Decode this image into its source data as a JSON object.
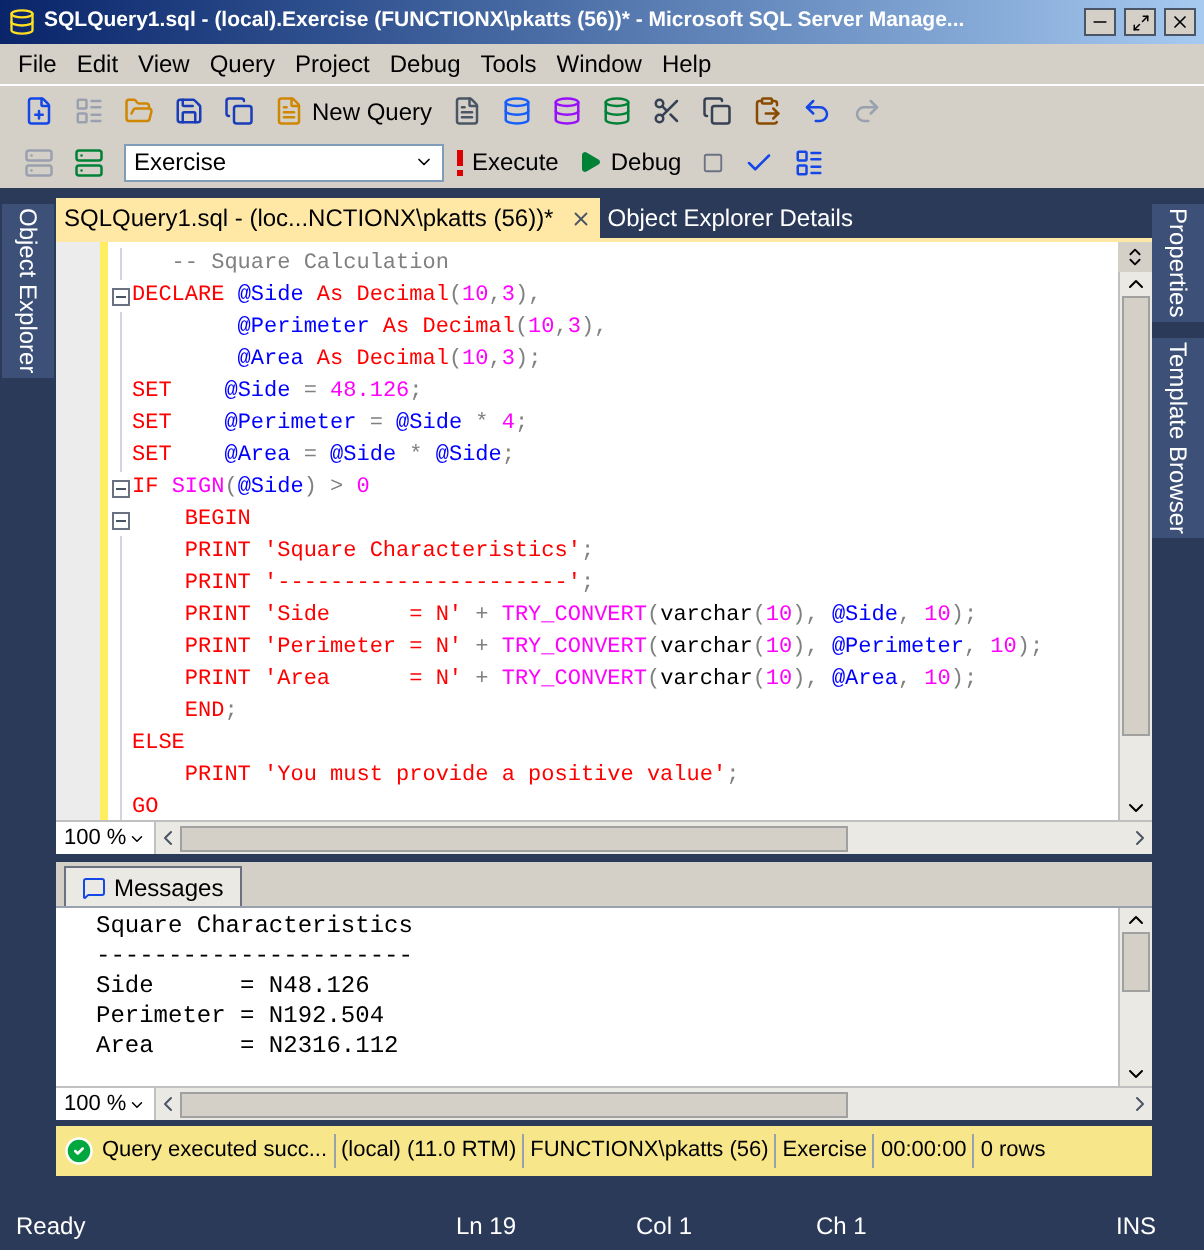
{
  "window": {
    "title": "SQLQuery1.sql - (local).Exercise (FUNCTIONX\\pkatts (56))* - Microsoft SQL Server Manage..."
  },
  "menu": [
    "File",
    "Edit",
    "View",
    "Query",
    "Project",
    "Debug",
    "Tools",
    "Window",
    "Help"
  ],
  "toolbar": {
    "new_query": "New Query",
    "database": "Exercise",
    "execute": "Execute",
    "debug": "Debug"
  },
  "side_left": [
    "Object Explorer"
  ],
  "side_right": [
    "Properties",
    "Template Browser"
  ],
  "tabs": [
    {
      "label": "SQLQuery1.sql - (loc...NCTIONX\\pkatts (56))*",
      "selected": true
    },
    {
      "label": "Object Explorer Details",
      "selected": false
    }
  ],
  "editor": {
    "lines": [
      {
        "fold": false,
        "tokens": [
          {
            "kind": "comment",
            "text": "   -- Square Calculation"
          }
        ]
      },
      {
        "fold": true,
        "tokens": [
          {
            "kind": "kw",
            "text": "DECLARE "
          },
          {
            "kind": "var",
            "text": "@Side "
          },
          {
            "kind": "kw",
            "text": "As Decimal"
          },
          {
            "kind": "op",
            "text": "("
          },
          {
            "kind": "num",
            "text": "10"
          },
          {
            "kind": "op",
            "text": ","
          },
          {
            "kind": "num",
            "text": "3"
          },
          {
            "kind": "op",
            "text": "),"
          }
        ]
      },
      {
        "fold": false,
        "tokens": [
          {
            "kind": "var",
            "text": "        @Perimeter "
          },
          {
            "kind": "kw",
            "text": "As Decimal"
          },
          {
            "kind": "op",
            "text": "("
          },
          {
            "kind": "num",
            "text": "10"
          },
          {
            "kind": "op",
            "text": ","
          },
          {
            "kind": "num",
            "text": "3"
          },
          {
            "kind": "op",
            "text": "),"
          }
        ]
      },
      {
        "fold": false,
        "tokens": [
          {
            "kind": "var",
            "text": "        @Area "
          },
          {
            "kind": "kw",
            "text": "As Decimal"
          },
          {
            "kind": "op",
            "text": "("
          },
          {
            "kind": "num",
            "text": "10"
          },
          {
            "kind": "op",
            "text": ","
          },
          {
            "kind": "num",
            "text": "3"
          },
          {
            "kind": "op",
            "text": ");"
          }
        ]
      },
      {
        "fold": false,
        "tokens": [
          {
            "kind": "kw",
            "text": "SET    "
          },
          {
            "kind": "var",
            "text": "@Side"
          },
          {
            "kind": "op",
            "text": " = "
          },
          {
            "kind": "num",
            "text": "48.126"
          },
          {
            "kind": "op",
            "text": ";"
          }
        ]
      },
      {
        "fold": false,
        "tokens": [
          {
            "kind": "kw",
            "text": "SET    "
          },
          {
            "kind": "var",
            "text": "@Perimeter"
          },
          {
            "kind": "op",
            "text": " = "
          },
          {
            "kind": "var",
            "text": "@Side"
          },
          {
            "kind": "op",
            "text": " * "
          },
          {
            "kind": "num",
            "text": "4"
          },
          {
            "kind": "op",
            "text": ";"
          }
        ]
      },
      {
        "fold": false,
        "tokens": [
          {
            "kind": "kw",
            "text": "SET    "
          },
          {
            "kind": "var",
            "text": "@Area"
          },
          {
            "kind": "op",
            "text": " = "
          },
          {
            "kind": "var",
            "text": "@Side"
          },
          {
            "kind": "op",
            "text": " * "
          },
          {
            "kind": "var",
            "text": "@Side"
          },
          {
            "kind": "op",
            "text": ";"
          }
        ]
      },
      {
        "fold": true,
        "tokens": [
          {
            "kind": "kw",
            "text": "IF "
          },
          {
            "kind": "fn",
            "text": "SIGN"
          },
          {
            "kind": "op",
            "text": "("
          },
          {
            "kind": "var",
            "text": "@Side"
          },
          {
            "kind": "op",
            "text": ") > "
          },
          {
            "kind": "num",
            "text": "0"
          }
        ]
      },
      {
        "fold": true,
        "tokens": [
          {
            "kind": "kw",
            "text": "    BEGIN"
          }
        ]
      },
      {
        "fold": false,
        "tokens": [
          {
            "kind": "kw",
            "text": "    PRINT "
          },
          {
            "kind": "str",
            "text": "'Square Characteristics'"
          },
          {
            "kind": "op",
            "text": ";"
          }
        ]
      },
      {
        "fold": false,
        "tokens": [
          {
            "kind": "kw",
            "text": "    PRINT "
          },
          {
            "kind": "str",
            "text": "'----------------------'"
          },
          {
            "kind": "op",
            "text": ";"
          }
        ]
      },
      {
        "fold": false,
        "tokens": [
          {
            "kind": "kw",
            "text": "    PRINT "
          },
          {
            "kind": "str",
            "text": "'Side      = N'"
          },
          {
            "kind": "op",
            "text": " + "
          },
          {
            "kind": "fn",
            "text": "TRY_CONVERT"
          },
          {
            "kind": "op",
            "text": "("
          },
          {
            "kind": "plain",
            "text": "varchar"
          },
          {
            "kind": "op",
            "text": "("
          },
          {
            "kind": "num",
            "text": "10"
          },
          {
            "kind": "op",
            "text": "), "
          },
          {
            "kind": "var",
            "text": "@Side"
          },
          {
            "kind": "op",
            "text": ", "
          },
          {
            "kind": "num",
            "text": "10"
          },
          {
            "kind": "op",
            "text": ");"
          }
        ]
      },
      {
        "fold": false,
        "tokens": [
          {
            "kind": "kw",
            "text": "    PRINT "
          },
          {
            "kind": "str",
            "text": "'Perimeter = N'"
          },
          {
            "kind": "op",
            "text": " + "
          },
          {
            "kind": "fn",
            "text": "TRY_CONVERT"
          },
          {
            "kind": "op",
            "text": "("
          },
          {
            "kind": "plain",
            "text": "varchar"
          },
          {
            "kind": "op",
            "text": "("
          },
          {
            "kind": "num",
            "text": "10"
          },
          {
            "kind": "op",
            "text": "), "
          },
          {
            "kind": "var",
            "text": "@Perimeter"
          },
          {
            "kind": "op",
            "text": ", "
          },
          {
            "kind": "num",
            "text": "10"
          },
          {
            "kind": "op",
            "text": ");"
          }
        ]
      },
      {
        "fold": false,
        "tokens": [
          {
            "kind": "kw",
            "text": "    PRINT "
          },
          {
            "kind": "str",
            "text": "'Area      = N'"
          },
          {
            "kind": "op",
            "text": " + "
          },
          {
            "kind": "fn",
            "text": "TRY_CONVERT"
          },
          {
            "kind": "op",
            "text": "("
          },
          {
            "kind": "plain",
            "text": "varchar"
          },
          {
            "kind": "op",
            "text": "("
          },
          {
            "kind": "num",
            "text": "10"
          },
          {
            "kind": "op",
            "text": "), "
          },
          {
            "kind": "var",
            "text": "@Area"
          },
          {
            "kind": "op",
            "text": ", "
          },
          {
            "kind": "num",
            "text": "10"
          },
          {
            "kind": "op",
            "text": ");"
          }
        ]
      },
      {
        "fold": false,
        "tokens": [
          {
            "kind": "kw",
            "text": "    END"
          },
          {
            "kind": "op",
            "text": ";"
          }
        ]
      },
      {
        "fold": false,
        "tokens": [
          {
            "kind": "kw",
            "text": "ELSE"
          }
        ]
      },
      {
        "fold": false,
        "tokens": [
          {
            "kind": "kw",
            "text": "    PRINT "
          },
          {
            "kind": "str",
            "text": "'You must provide a positive value'"
          },
          {
            "kind": "op",
            "text": ";"
          }
        ]
      },
      {
        "fold": false,
        "tokens": [
          {
            "kind": "kw",
            "text": "GO"
          }
        ]
      }
    ],
    "zoom": "100 %"
  },
  "results": {
    "tab": "Messages",
    "lines": [
      "Square Characteristics",
      "----------------------",
      "Side      = N48.126",
      "Perimeter = N192.504",
      "Area      = N2316.112"
    ],
    "zoom": "100 %"
  },
  "query_status": {
    "message": "Query executed succ...",
    "server": "(local) (11.0 RTM)",
    "user": "FUNCTIONX\\pkatts (56)",
    "database": "Exercise",
    "time": "00:00:00",
    "rows": "0 rows"
  },
  "status_bar": {
    "state": "Ready",
    "line": "Ln 19",
    "column": "Col 1",
    "char": "Ch 1",
    "mode": "INS"
  }
}
